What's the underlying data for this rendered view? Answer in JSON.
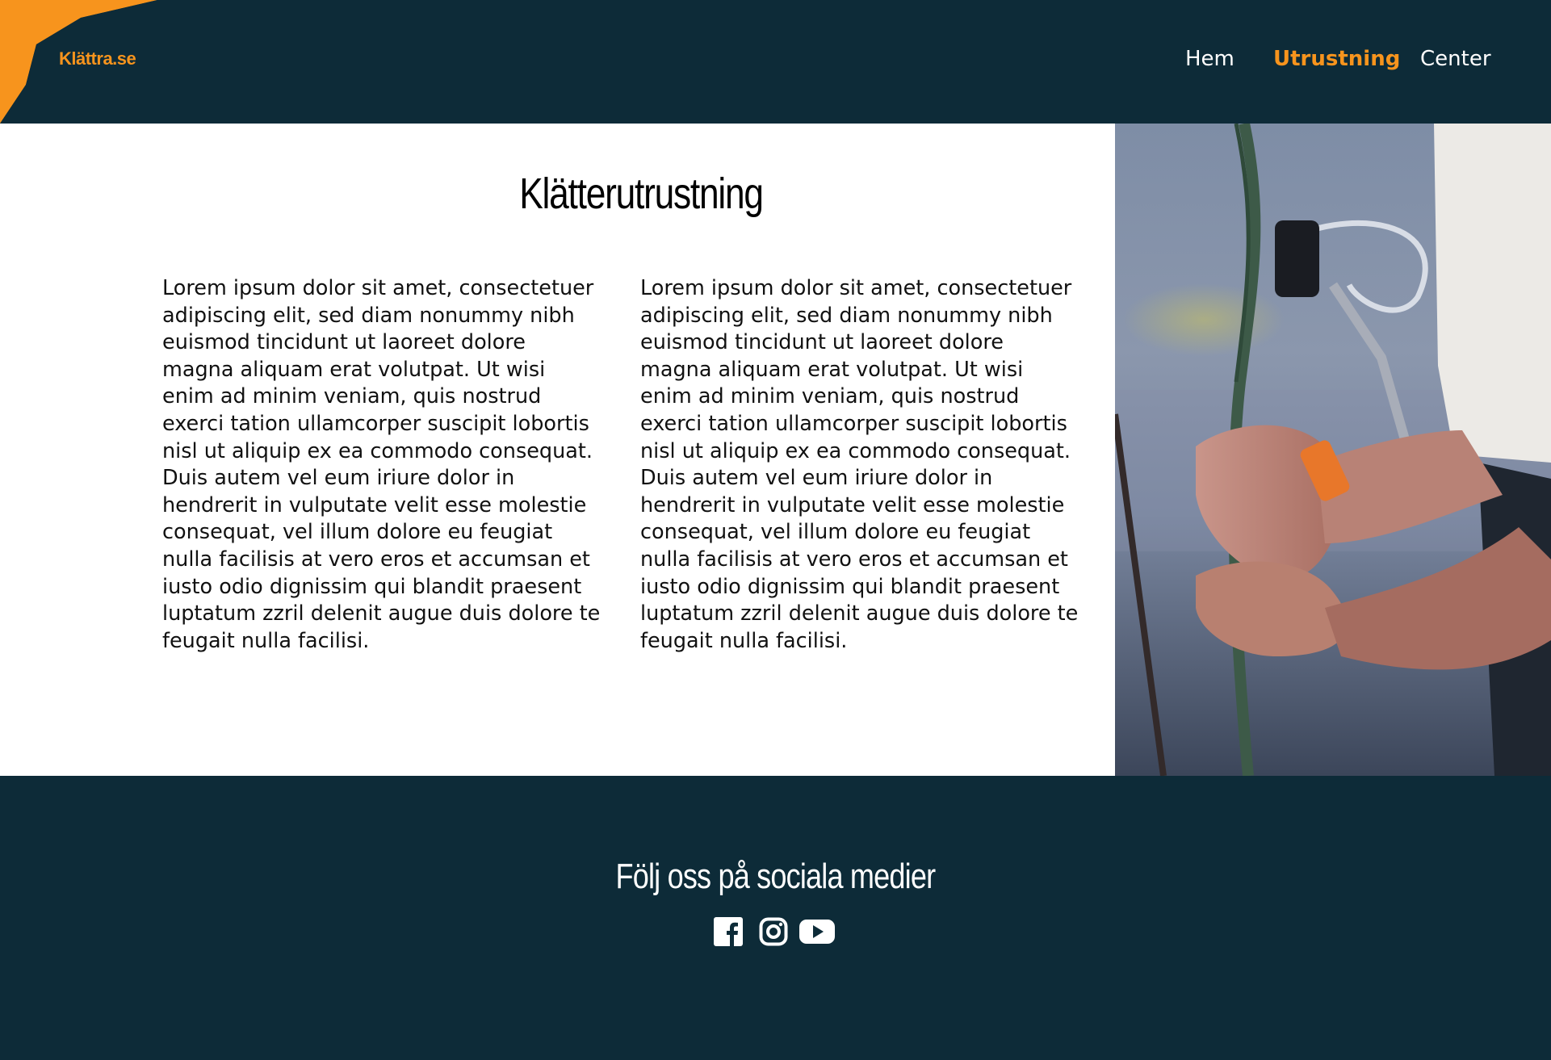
{
  "brand": {
    "logo_text": "Klättra.se",
    "accent_color": "#f7941d",
    "dark_color": "#0d2b38"
  },
  "nav": {
    "items": [
      {
        "label": "Hem",
        "active": false
      },
      {
        "label": "Utrustning",
        "active": true
      },
      {
        "label": "Center",
        "active": false
      }
    ]
  },
  "main": {
    "title": "Klätterutrustning",
    "paragraphs": [
      "Lorem ipsum dolor sit amet, consectetuer adipiscing elit, sed diam nonummy nibh euismod tincidunt ut laoreet dolore magna aliquam erat volutpat. Ut wisi enim ad minim veniam, quis nostrud exerci tation ullamcorper suscipit lobortis nisl ut aliquip ex ea commodo consequat. Duis autem vel eum iriure dolor in hendrerit in vulputate velit esse molestie consequat, vel illum dolore eu feugiat nulla facilisis at vero eros et accumsan et iusto odio dignissim qui blandit praesent luptatum zzril delenit augue duis dolore te feugait nulla facilisi.",
      "Lorem ipsum dolor sit amet, consectetuer adipiscing elit, sed diam nonummy nibh euismod tincidunt ut laoreet dolore magna aliquam erat volutpat. Ut wisi enim ad minim veniam, quis nostrud exerci tation ullamcorper suscipit lobortis nisl ut aliquip ex ea commodo consequat. Duis autem vel eum iriure dolor in hendrerit in vulputate velit esse molestie consequat, vel illum dolore eu feugiat nulla facilisis at vero eros et accumsan et iusto odio dignissim qui blandit praesent luptatum zzril delenit augue duis dolore te feugait nulla facilisi."
    ],
    "photo_icon": "climber-hands-rope-photo"
  },
  "footer": {
    "heading": "Följ oss på sociala medier",
    "social": [
      "facebook-icon",
      "instagram-icon",
      "youtube-icon"
    ]
  }
}
